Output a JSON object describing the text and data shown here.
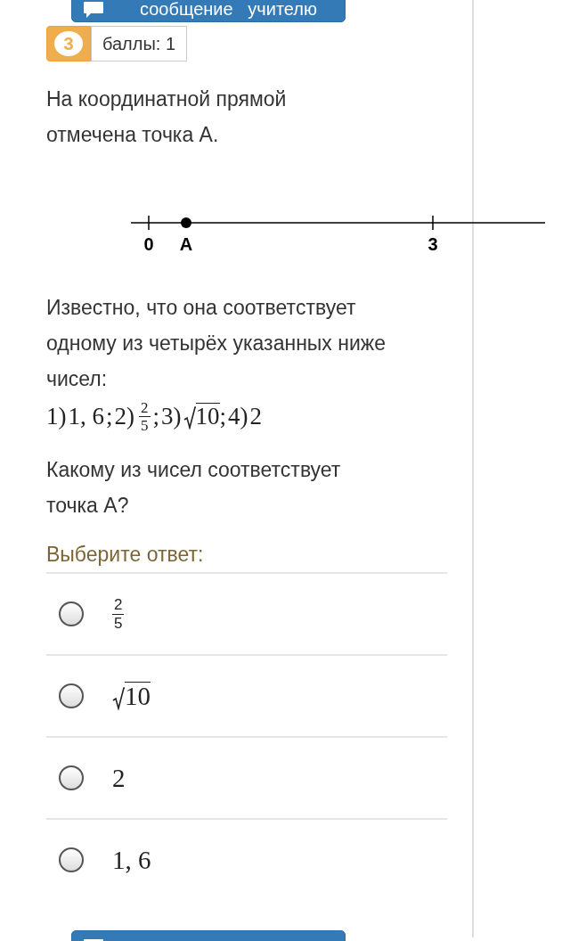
{
  "top_button": {
    "label": "сообщение   учителю"
  },
  "question": {
    "number": "3",
    "points": "баллы: 1"
  },
  "intro": "На координатной прямой отмечена точка A.",
  "number_line": {
    "ticks": [
      {
        "label": "0"
      },
      {
        "label": "3"
      }
    ],
    "point": {
      "label": "A"
    }
  },
  "statement": "Известно, что она соответствует одному из четырёх указанных ниже чисел:",
  "numbers": [
    {
      "prefix": "1)",
      "kind": "plain",
      "value": "1, 6",
      "suffix": ";"
    },
    {
      "prefix": "2)",
      "kind": "fraction",
      "numerator": "2",
      "denominator": "5",
      "suffix": ";"
    },
    {
      "prefix": "3)",
      "kind": "sqrt",
      "value": "10",
      "suffix": ";"
    },
    {
      "prefix": "4)",
      "kind": "plain",
      "value": "2"
    }
  ],
  "ask": "Какому из чисел соответствует точка A?",
  "answer_prompt": "Выберите ответ:",
  "options": [
    {
      "kind": "fraction",
      "numerator": "2",
      "denominator": "5",
      "selected": false
    },
    {
      "kind": "sqrt",
      "value": "10",
      "selected": false
    },
    {
      "kind": "plain",
      "value": "2",
      "selected": false
    },
    {
      "kind": "plain",
      "value": "1, 6",
      "selected": false
    }
  ],
  "bottom_button": {
    "kind": "message"
  }
}
